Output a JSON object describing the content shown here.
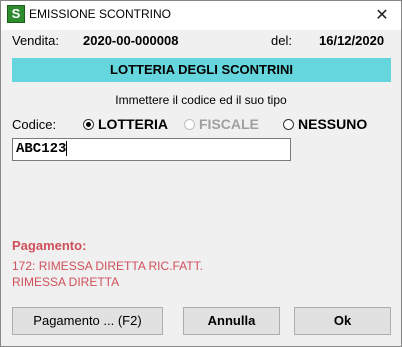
{
  "window": {
    "title": "EMISSIONE SCONTRINO",
    "app_icon": "S",
    "close_glyph": "✕"
  },
  "header": {
    "sale_label": "Vendita:",
    "sale_number": "2020-00-000008",
    "date_label": "del:",
    "date": "16/12/2020"
  },
  "banner": "LOTTERIA DEGLI SCONTRINI",
  "instruction": "Immettere il codice ed il suo tipo",
  "code": {
    "label": "Codice:",
    "options": [
      {
        "label": "LOTTERIA",
        "selected": true,
        "enabled": true
      },
      {
        "label": "FISCALE",
        "selected": false,
        "enabled": false
      },
      {
        "label": "NESSUNO",
        "selected": false,
        "enabled": true
      }
    ],
    "value": "ABC123"
  },
  "payment": {
    "title": "Pagamento:",
    "line1": "172: RIMESSA DIRETTA RIC.FATT.",
    "line2": "RIMESSA DIRETTA",
    "color": "#d0505a"
  },
  "buttons": {
    "payment": "Pagamento ... (F2)",
    "cancel": "Annulla",
    "ok": "Ok"
  }
}
